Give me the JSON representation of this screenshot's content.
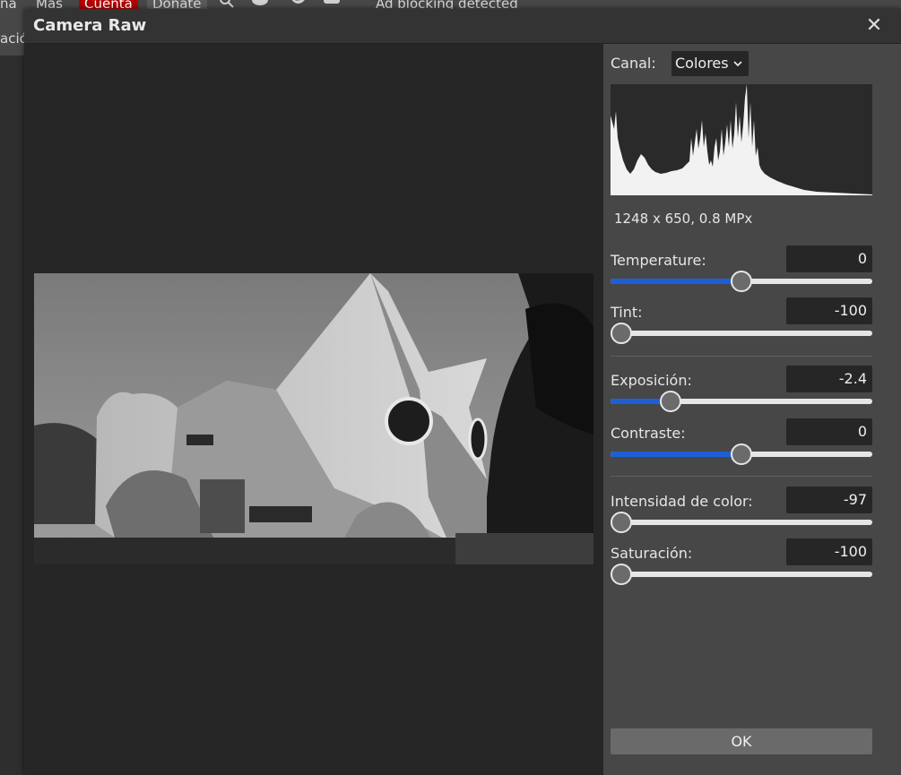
{
  "app": {
    "menu": {
      "item_partial_left": "na",
      "item_mas": "Más",
      "item_cuenta": "Cuenta",
      "item_donate": "Donate",
      "ad_notice": "Ad blocking detected"
    },
    "second_bar_text": "ación"
  },
  "dialog": {
    "title": "Camera Raw",
    "close_glyph": "✕",
    "channel": {
      "label": "Canal:",
      "selected": "Colores"
    },
    "image_info": "1248 x 650, 0.8 MPx",
    "controls": {
      "temperature": {
        "label": "Temperature:",
        "value": "0",
        "level": 0.5
      },
      "tint": {
        "label": "Tint:",
        "value": "-100",
        "level": 0.0
      },
      "exposicion": {
        "label": "Exposición:",
        "value": "-2.4",
        "level": 0.23
      },
      "contraste": {
        "label": "Contraste:",
        "value": "0",
        "level": 0.5
      },
      "intensidad": {
        "label": "Intensidad de color:",
        "value": "-97",
        "level": 0.015
      },
      "saturacion": {
        "label": "Saturación:",
        "value": "-100",
        "level": 0.0
      }
    },
    "ok_label": "OK"
  },
  "colors": {
    "accent": "#1e5fd6",
    "panel": "#474747",
    "dialog_bg": "#2b2b2b",
    "cuenta": "#b30000"
  },
  "icons": [
    "search-icon",
    "reddit-icon",
    "twitter-icon",
    "facebook-icon",
    "close-icon",
    "chevron-down-icon"
  ]
}
